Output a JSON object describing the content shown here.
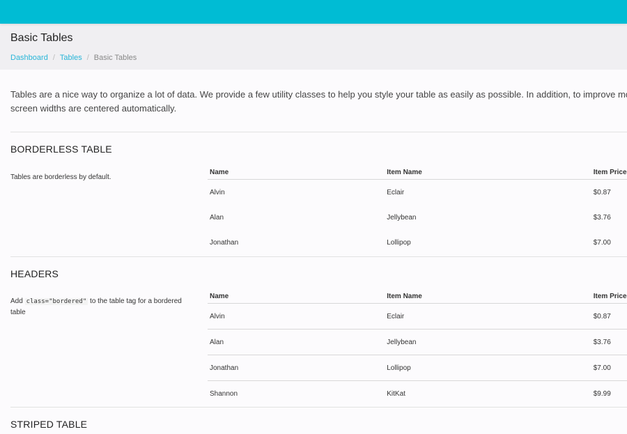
{
  "header": {
    "title": "Basic Tables",
    "breadcrumb": [
      "Dashboard",
      "Tables",
      "Basic Tables"
    ]
  },
  "intro": {
    "line1": "Tables are a nice way to organize a lot of data. We provide a few utility classes to help you style your table as easily as possible. In addition, to improve mo",
    "line2": "screen widths are centered automatically."
  },
  "sections": {
    "borderless": {
      "title": "BORDERLESS TABLE",
      "description": "Tables are borderless by default.",
      "columns": [
        "Name",
        "Item Name",
        "Item Price"
      ],
      "rows": [
        [
          "Alvin",
          "Eclair",
          "$0.87"
        ],
        [
          "Alan",
          "Jellybean",
          "$3.76"
        ],
        [
          "Jonathan",
          "Lollipop",
          "$7.00"
        ]
      ]
    },
    "headers": {
      "title": "HEADERS",
      "description_prefix": "Add ",
      "description_code": "class=\"bordered\"",
      "description_suffix": " to the table tag for a bordered table",
      "columns": [
        "Name",
        "Item Name",
        "Item Price"
      ],
      "rows": [
        [
          "Alvin",
          "Eclair",
          "$0.87"
        ],
        [
          "Alan",
          "Jellybean",
          "$3.76"
        ],
        [
          "Jonathan",
          "Lollipop",
          "$7.00"
        ],
        [
          "Shannon",
          "KitKat",
          "$9.99"
        ]
      ]
    },
    "striped": {
      "title": "STRIPED TABLE"
    }
  },
  "colors": {
    "topbar": "#00bcd4",
    "link": "#29b6d8",
    "header_bg": "#f0eff2",
    "page_bg": "#fcfbfd"
  }
}
